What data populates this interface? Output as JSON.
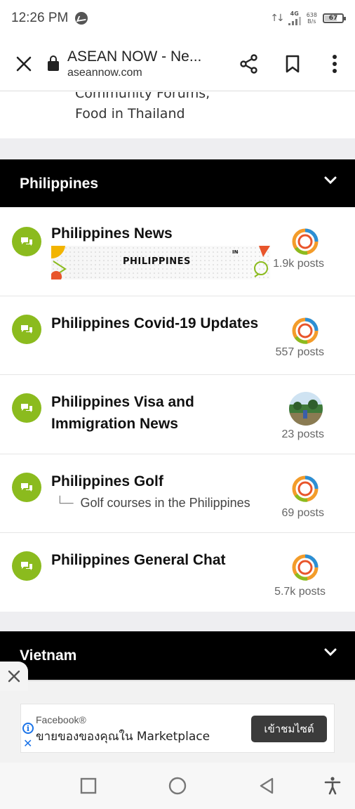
{
  "status_bar": {
    "time": "12:26 PM",
    "network": "4G",
    "net_speed_value": "638",
    "net_speed_unit": "B/s",
    "battery": "67"
  },
  "browser": {
    "title": "ASEAN NOW - Ne...",
    "url": "aseannow.com"
  },
  "previous_card": {
    "line1": "Community Forums,",
    "line2": "Food in Thailand"
  },
  "sections": [
    {
      "title": "Philippines",
      "forums": [
        {
          "title": "Philippines News",
          "posts": "1.9k  posts",
          "banner_text": "PHILIPPINES",
          "banner_small": "IN",
          "avatar": "ring-logo-icon"
        },
        {
          "title": "Philippines Covid-19 Updates",
          "posts": "557  posts",
          "avatar": "ring-logo-icon"
        },
        {
          "title": "Philippines Visa and Immigration News",
          "posts": "23  posts",
          "avatar": "photo-avatar"
        },
        {
          "title": "Philippines Golf",
          "subforum": "Golf courses in the Philippines",
          "posts": "69  posts",
          "avatar": "ring-logo-icon"
        },
        {
          "title": "Philippines General Chat",
          "posts": "5.7k  posts",
          "avatar": "ring-logo-icon"
        }
      ]
    },
    {
      "title": "Vietnam"
    }
  ],
  "ad": {
    "brand": "Facebook®",
    "text": "ขายของของคุณใน Marketplace",
    "cta": "เข้าชมไซต์"
  },
  "colors": {
    "forum_icon_green": "#8bbb1e",
    "header_black": "#000000",
    "ring_orange": "#f39c2a",
    "ring_blue": "#2b8fd6"
  }
}
